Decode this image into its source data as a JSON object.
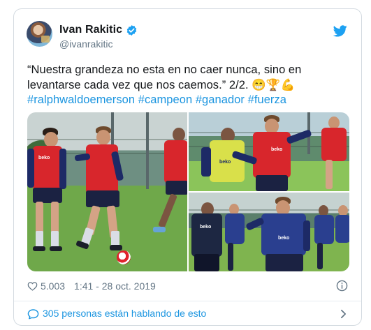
{
  "author": {
    "display_name": "Ivan Rakitic",
    "handle": "@ivanrakitic"
  },
  "tweet": {
    "text_plain": "“Nuestra grandeza no esta en no caer nunca, sino en levantarse cada vez que nos caemos.” 2/2.",
    "emojis": "😁🏆💪",
    "hashtags": [
      "#ralphwaldoemerson",
      "#campeon",
      "#ganador",
      "#fuerza"
    ]
  },
  "media": {
    "photo_count": 3,
    "jersey_sponsor": "beko"
  },
  "meta": {
    "likes": "5.003",
    "timestamp": "1:41 - 28 oct. 2019"
  },
  "footer": {
    "conversation_text": "305 personas están hablando de esto"
  },
  "colors": {
    "link": "#1b95e0",
    "text": "#14171a",
    "muted": "#657786",
    "border": "#d4dbe1",
    "verified": "#1da1f2"
  },
  "icons": [
    "verified-badge-icon",
    "twitter-bird-icon",
    "heart-icon",
    "info-icon",
    "comment-icon",
    "chevron-right-icon"
  ]
}
